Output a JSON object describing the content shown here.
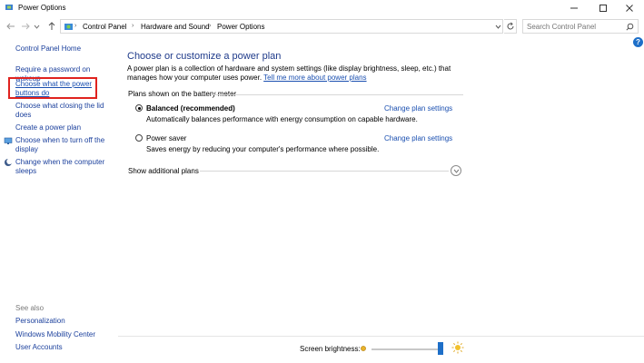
{
  "window": {
    "title": "Power Options",
    "controls": [
      "minimize",
      "maximize",
      "close"
    ]
  },
  "nav": {
    "back_icon": "back-arrow-icon",
    "forward_icon": "forward-arrow-icon",
    "recent_icon": "chevron-down-icon",
    "up_icon": "up-arrow-icon"
  },
  "address": {
    "crumbs": [
      "Control Panel",
      "Hardware and Sound",
      "Power Options"
    ]
  },
  "search": {
    "placeholder": "Search Control Panel"
  },
  "sidebar": {
    "home": "Control Panel Home",
    "items": [
      "Require a password on wakeup",
      "Choose what the power buttons do",
      "Choose what closing the lid does",
      "Create a power plan",
      "Choose when to turn off the display",
      "Change when the computer sleeps"
    ],
    "see_also_title": "See also",
    "see_also": [
      "Personalization",
      "Windows Mobility Center",
      "User Accounts"
    ]
  },
  "main": {
    "heading": "Choose or customize a power plan",
    "intro": "A power plan is a collection of hardware and system settings (like display brightness, sleep, etc.) that manages how your computer uses power.",
    "intro_link": "Tell me more about power plans",
    "group_label": "Plans shown on the battery meter",
    "plans": [
      {
        "name": "Balanced (recommended)",
        "description": "Automatically balances performance with energy consumption on capable hardware.",
        "selected": true,
        "settings_link": "Change plan settings"
      },
      {
        "name": "Power saver",
        "description": "Saves energy by reducing your computer's performance where possible.",
        "selected": false,
        "settings_link": "Change plan settings"
      }
    ],
    "show_additional": "Show additional plans"
  },
  "bottom": {
    "brightness_label": "Screen brightness:",
    "brightness_level": 1.0
  },
  "colors": {
    "link": "#1a4fb0",
    "heading": "#1e3a8a",
    "highlight_box": "#e0231f",
    "slider_thumb": "#1e6fc8"
  }
}
